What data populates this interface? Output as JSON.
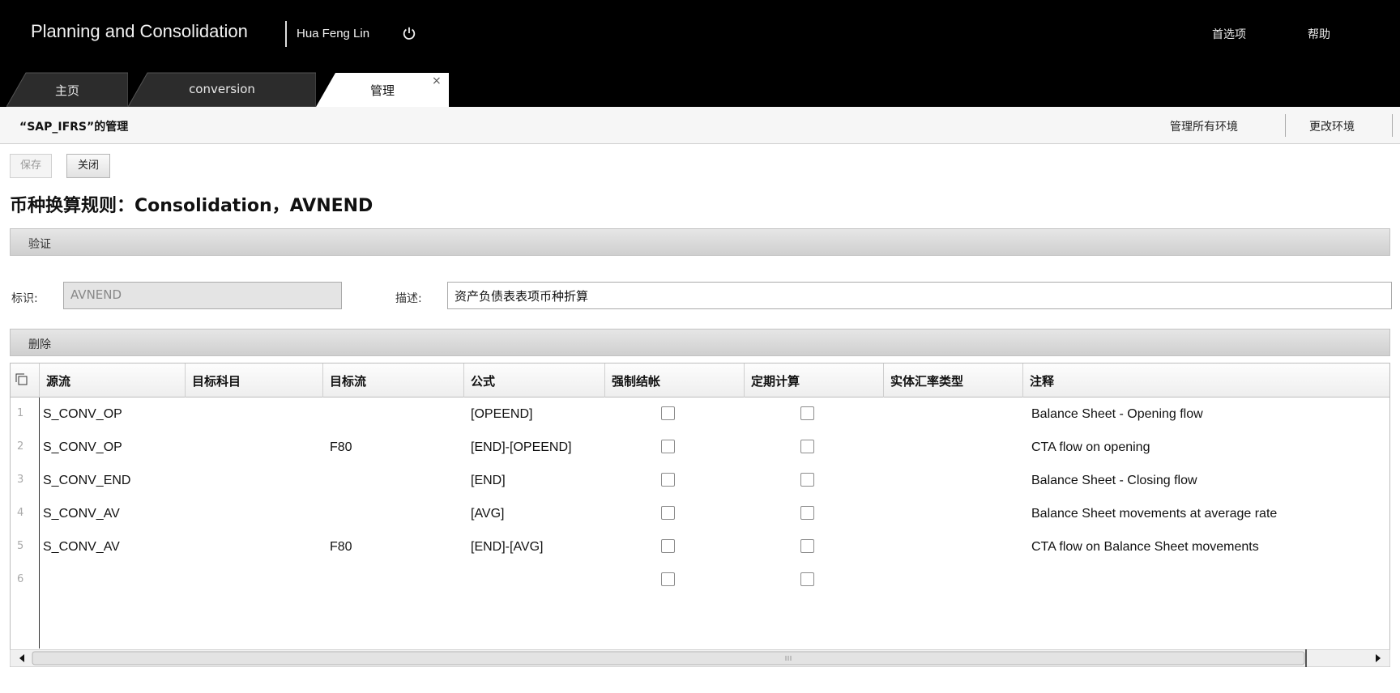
{
  "header": {
    "app_title": "Planning and Consolidation",
    "user_name": "Hua Feng Lin",
    "preferences": "首选项",
    "help": "帮助"
  },
  "tabs": [
    {
      "label": "主页",
      "active": false
    },
    {
      "label": "conversion",
      "active": false
    },
    {
      "label": "管理",
      "active": true,
      "close": "×"
    }
  ],
  "subheader": {
    "title": "“SAP_IFRS”的管理",
    "manage_all": "管理所有环境",
    "change_env": "更改环境"
  },
  "toolbar": {
    "save": "保存",
    "close": "关闭"
  },
  "page_heading": "币种换算规则：Consolidation，AVNEND",
  "sections": {
    "validate": "验证",
    "delete": "删除"
  },
  "form": {
    "id_label": "标识:",
    "id_value": "AVNEND",
    "desc_label": "描述:",
    "desc_value": "资产负债表表项币种折算"
  },
  "table": {
    "columns": [
      "源流",
      "目标科目",
      "目标流",
      "公式",
      "强制结帐",
      "定期计算",
      "实体汇率类型",
      "注释"
    ],
    "rows": [
      {
        "num": "1",
        "source_flow": "S_CONV_OP",
        "target_account": "",
        "target_flow": "",
        "formula": "[OPEEND]",
        "force_close": false,
        "periodic": false,
        "rate_type": "",
        "comment": "Balance Sheet - Opening flow"
      },
      {
        "num": "2",
        "source_flow": "S_CONV_OP",
        "target_account": "",
        "target_flow": "F80",
        "formula": "[END]-[OPEEND]",
        "force_close": false,
        "periodic": false,
        "rate_type": "",
        "comment": "CTA flow on opening"
      },
      {
        "num": "3",
        "source_flow": "S_CONV_END",
        "target_account": "",
        "target_flow": "",
        "formula": "[END]",
        "force_close": false,
        "periodic": false,
        "rate_type": "",
        "comment": "Balance Sheet - Closing flow"
      },
      {
        "num": "4",
        "source_flow": "S_CONV_AV",
        "target_account": "",
        "target_flow": "",
        "formula": "[AVG]",
        "force_close": false,
        "periodic": false,
        "rate_type": "",
        "comment": "Balance Sheet movements at average rate"
      },
      {
        "num": "5",
        "source_flow": "S_CONV_AV",
        "target_account": "",
        "target_flow": "F80",
        "formula": "[END]-[AVG]",
        "force_close": false,
        "periodic": false,
        "rate_type": "",
        "comment": "CTA flow on Balance Sheet movements"
      },
      {
        "num": "6",
        "source_flow": "",
        "target_account": "",
        "target_flow": "",
        "formula": "",
        "force_close": false,
        "periodic": false,
        "rate_type": "",
        "comment": ""
      }
    ]
  },
  "colors": {
    "header_bg": "#000000",
    "section_bar": "#d6d6d6",
    "disabled_input": "#e4e4e4"
  }
}
